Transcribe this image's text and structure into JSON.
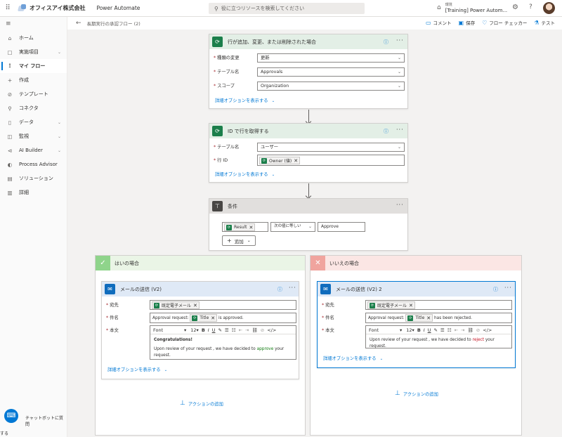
{
  "topbar": {
    "org_name": "オフィスアイ株式会社",
    "app_name": "Power Automate",
    "search_placeholder": "役に立つリソースを検索してください",
    "env_label": "環境",
    "env_name": "[Training] Power Autom..."
  },
  "sidebar": {
    "items": [
      {
        "label": "ホーム",
        "icon": "home-icon",
        "glyph": "⌂",
        "chevron": false
      },
      {
        "label": "実施項目",
        "icon": "clipboard-icon",
        "glyph": "▢",
        "chevron": true
      },
      {
        "label": "マイ フロー",
        "icon": "flow-icon",
        "glyph": "⟟",
        "chevron": false,
        "active": true
      },
      {
        "label": "作成",
        "icon": "plus-icon",
        "glyph": "+",
        "chevron": false
      },
      {
        "label": "テンプレート",
        "icon": "template-icon",
        "glyph": "⊘",
        "chevron": false
      },
      {
        "label": "コネクタ",
        "icon": "connector-icon",
        "glyph": "⚲",
        "chevron": false
      },
      {
        "label": "データ",
        "icon": "data-icon",
        "glyph": "▯",
        "chevron": true
      },
      {
        "label": "監視",
        "icon": "monitor-icon",
        "glyph": "◫",
        "chevron": true
      },
      {
        "label": "AI Builder",
        "icon": "ai-builder-icon",
        "glyph": "⊲",
        "chevron": true
      },
      {
        "label": "Process Advisor",
        "icon": "process-advisor-icon",
        "glyph": "◐",
        "chevron": false
      },
      {
        "label": "ソリューション",
        "icon": "solution-icon",
        "glyph": "▤",
        "chevron": false
      },
      {
        "label": "詳細",
        "icon": "book-icon",
        "glyph": "▥",
        "chevron": false
      }
    ],
    "chatbot_label": "チャットボットに質問",
    "bottom_text": "する"
  },
  "subbar": {
    "flow_name": "長期実行の承認フロー (2)",
    "comment": "コメント",
    "save": "保存",
    "checker": "フロー チェッカー",
    "test": "テスト"
  },
  "trigger": {
    "title": "行が追加、変更、または削除された場合",
    "change_label": "種類の変更",
    "change_value": "更新",
    "table_label": "テーブル名",
    "table_value": "Approvals",
    "scope_label": "スコープ",
    "scope_value": "Organization",
    "adv": "詳細オプションを表示する"
  },
  "getrow": {
    "title": "ID で行を取得する",
    "table_label": "テーブル名",
    "table_value": "ユーザー",
    "row_label": "行 ID",
    "row_token": "Owner (値)",
    "adv": "詳細オプションを表示する"
  },
  "condition": {
    "title": "条件",
    "left_token": "Result",
    "operator": "次の値に等しい",
    "right_value": "Approve",
    "add": "追加"
  },
  "yes": {
    "title": "はいの場合",
    "action_title": "メールの送信 (V2)",
    "to_label": "宛先",
    "to_token": "既定電子メール",
    "subject_label": "件名",
    "subject_prefix": "Approval request:",
    "subject_token": "Title",
    "subject_suffix": "is approved.",
    "body_label": "本文",
    "font": "Font",
    "size": "12",
    "body_heading": "Congratulations!",
    "body_pre": "Upon review of your request , we have decided to",
    "body_word": "approve",
    "body_post": "your request.",
    "adv": "詳細オプションを表示する",
    "add_action": "アクションの追加"
  },
  "no": {
    "title": "いいえの場合",
    "action_title": "メールの送信 (V2) 2",
    "to_label": "宛先",
    "to_token": "既定電子メール",
    "subject_label": "件名",
    "subject_prefix": "Approval request:",
    "subject_token": "Title",
    "subject_suffix": "has been rejected.",
    "body_label": "本文",
    "font": "Font",
    "size": "12",
    "body_pre": "Upon review of your request , we have decided to",
    "body_word": "reject",
    "body_post": "your request.",
    "adv": "詳細オプションを表示する",
    "add_action": "アクションの追加"
  },
  "colors": {
    "accent": "#0078d4",
    "dataverse_green": "#1b7f4b",
    "yes_branch": "#8fd48b",
    "no_branch": "#f0a49e"
  }
}
